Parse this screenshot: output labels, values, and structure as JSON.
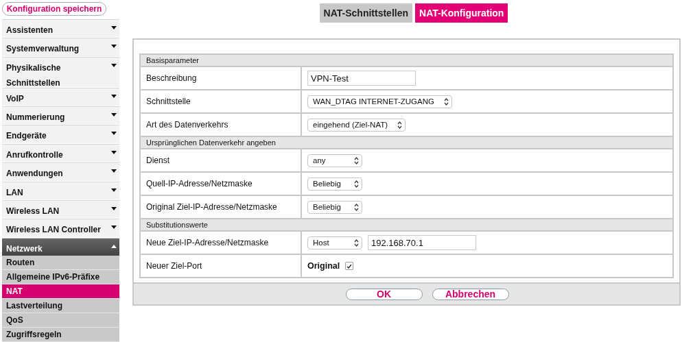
{
  "sidebar": {
    "save_button": "Konfiguration speichern",
    "items": [
      {
        "label": "Assistenten",
        "expanded": false
      },
      {
        "label": "Systemverwaltung",
        "expanded": false
      },
      {
        "label": "Physikalische Schnittstellen",
        "expanded": false
      },
      {
        "label": "VoIP",
        "expanded": false
      },
      {
        "label": "Nummerierung",
        "expanded": false
      },
      {
        "label": "Endgeräte",
        "expanded": false
      },
      {
        "label": "Anrufkontrolle",
        "expanded": false
      },
      {
        "label": "Anwendungen",
        "expanded": false
      },
      {
        "label": "LAN",
        "expanded": false
      },
      {
        "label": "Wireless LAN",
        "expanded": false
      },
      {
        "label": "Wireless LAN Controller",
        "expanded": false
      },
      {
        "label": "Netzwerk",
        "expanded": true,
        "children": [
          {
            "label": "Routen",
            "selected": false
          },
          {
            "label": "Allgemeine IPv6-Präfixe",
            "selected": false
          },
          {
            "label": "NAT",
            "selected": true
          },
          {
            "label": "Lastverteilung",
            "selected": false
          },
          {
            "label": "QoS",
            "selected": false
          },
          {
            "label": "Zugriffsregeln",
            "selected": false
          }
        ]
      }
    ]
  },
  "tabs": [
    {
      "label": "NAT-Schnittstellen",
      "selected": false
    },
    {
      "label": "NAT-Konfiguration",
      "selected": true
    }
  ],
  "sections": [
    {
      "title": "Basisparameter",
      "rows": [
        {
          "label": "Beschreibung",
          "kind": "text",
          "value": "VPN-Test"
        },
        {
          "label": "Schnittstelle",
          "kind": "select",
          "value": "WAN_DTAG INTERNET-ZUGANG"
        },
        {
          "label": "Art des Datenverkehrs",
          "kind": "select",
          "value": "eingehend (Ziel-NAT)"
        }
      ]
    },
    {
      "title": "Ursprünglichen Datenverkehr angeben",
      "rows": [
        {
          "label": "Dienst",
          "kind": "select",
          "value": "any"
        },
        {
          "label": "Quell-IP-Adresse/Netzmaske",
          "kind": "select",
          "value": "Beliebig"
        },
        {
          "label": "Original Ziel-IP-Adresse/Netzmaske",
          "kind": "select",
          "value": "Beliebig"
        }
      ]
    },
    {
      "title": "Substitutionswerte",
      "rows": [
        {
          "label": "Neue Ziel-IP-Adresse/Netzmaske",
          "kind": "select_text",
          "value": "Host",
          "value_2": "192.168.70.1"
        },
        {
          "label": "Neuer Ziel-Port",
          "kind": "checkbox",
          "value": "Original",
          "checked": true
        }
      ]
    }
  ],
  "buttons": [
    "OK",
    "Abbrechen"
  ]
}
